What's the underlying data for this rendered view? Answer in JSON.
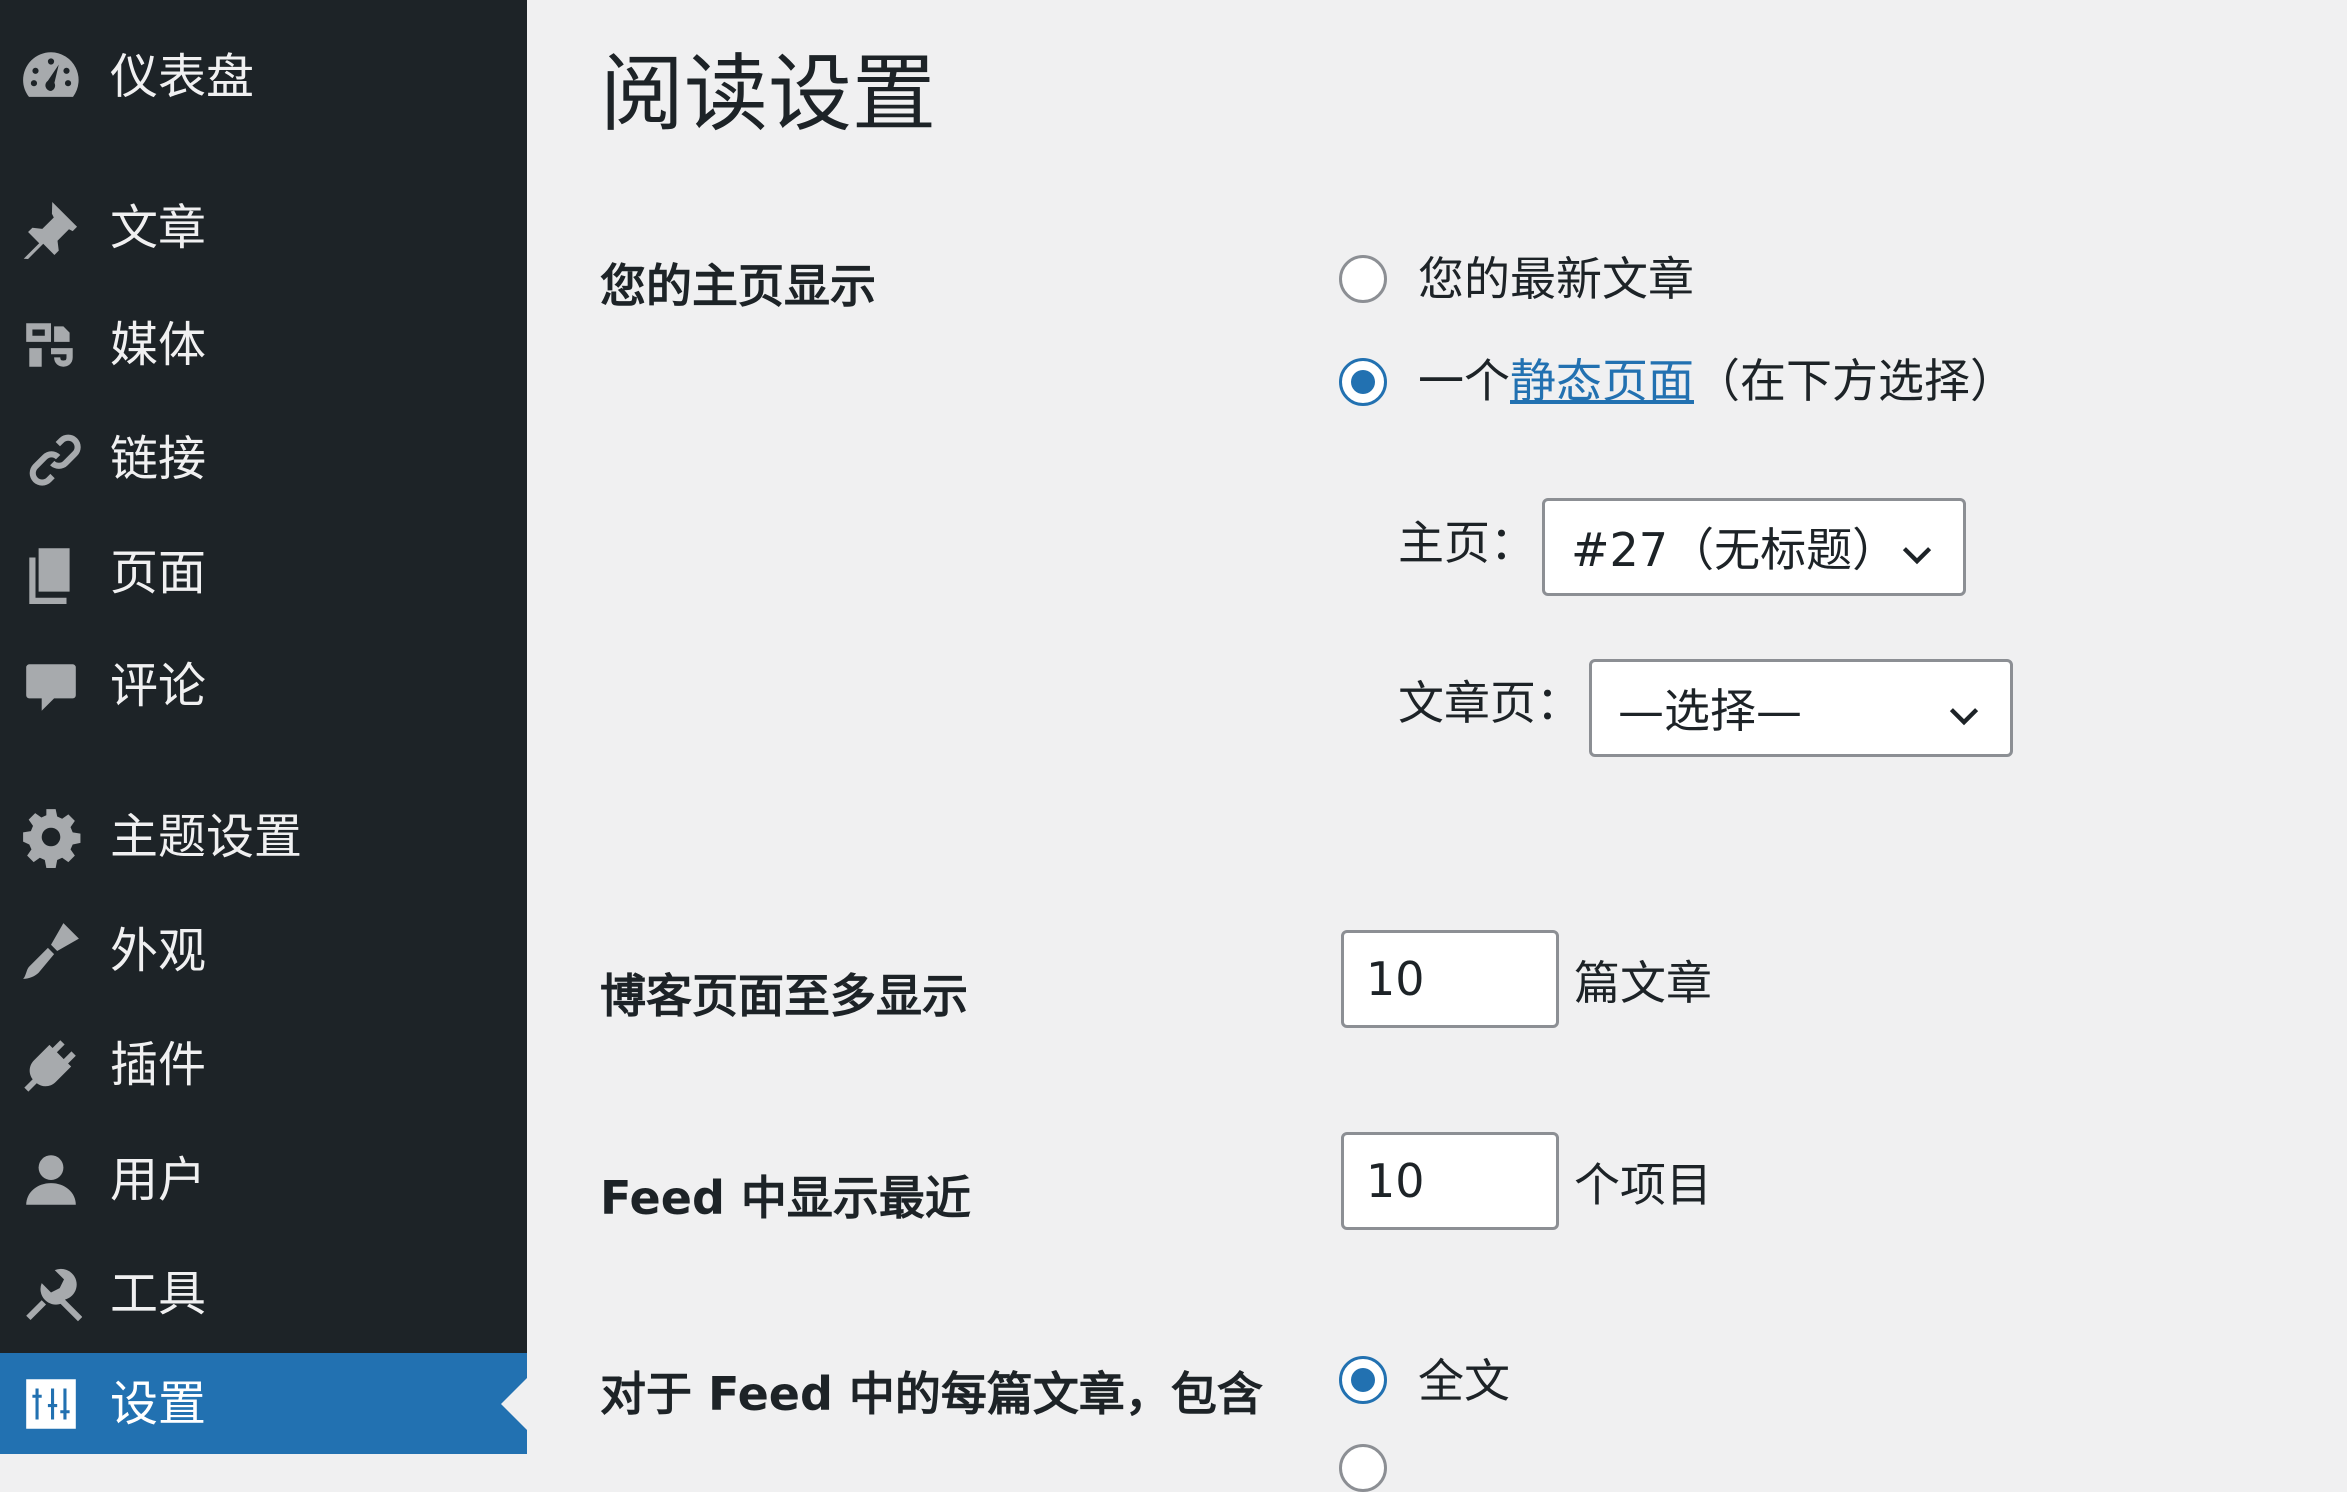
{
  "sidebar": {
    "items": [
      {
        "label": "仪表盘",
        "icon": "dashboard-icon"
      },
      {
        "label": "文章",
        "icon": "pin-icon"
      },
      {
        "label": "媒体",
        "icon": "media-icon"
      },
      {
        "label": "链接",
        "icon": "link-icon"
      },
      {
        "label": "页面",
        "icon": "pages-icon"
      },
      {
        "label": "评论",
        "icon": "comment-icon"
      },
      {
        "label": "主题设置",
        "icon": "gear-icon"
      },
      {
        "label": "外观",
        "icon": "brush-icon"
      },
      {
        "label": "插件",
        "icon": "plugin-icon"
      },
      {
        "label": "用户",
        "icon": "user-icon"
      },
      {
        "label": "工具",
        "icon": "wrench-icon"
      },
      {
        "label": "设置",
        "icon": "settings-icon",
        "active": true
      }
    ]
  },
  "main": {
    "title": "阅读设置",
    "homepage_display": {
      "label": "您的主页显示",
      "option_latest": "您的最新文章",
      "option_static_prefix": "一个",
      "option_static_link": "静态页面",
      "option_static_suffix": "（在下方选择）",
      "homepage_label": "主页：",
      "homepage_value": "#27（无标题）",
      "posts_page_label": "文章页：",
      "posts_page_value": "—选择—"
    },
    "blog_pages": {
      "label": "博客页面至多显示",
      "value": "10",
      "suffix": "篇文章"
    },
    "feed_recent": {
      "label": "Feed 中显示最近",
      "value": "10",
      "suffix": "个项目"
    },
    "feed_include": {
      "label": "对于 Feed 中的每篇文章，包含",
      "option_full": "全文"
    }
  },
  "colors": {
    "sidebar_bg": "#1d2327",
    "active_bg": "#2271b1",
    "link": "#2271b1",
    "page_bg": "#f0f0f1"
  }
}
